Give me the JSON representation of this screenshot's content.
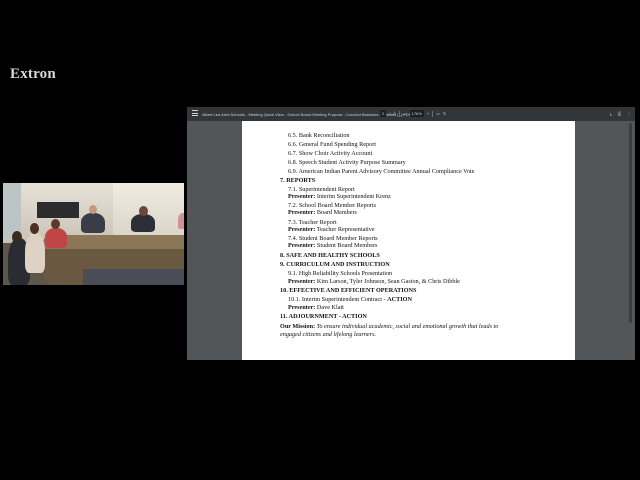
{
  "brand": {
    "logo": "Extron"
  },
  "viewer": {
    "title": "Albert Lea Area Schools - Meeting Quick View - School Board Meeting Purpose : Conduct Business of District (1).PDF",
    "page_current": "2",
    "page_sep": "/",
    "page_total": "2",
    "zoom_out": "—",
    "zoom": "176%",
    "zoom_in": "+",
    "fit_icon": "fit-page-icon",
    "rotate_icon": "rotate-icon",
    "download_icon": "⤓",
    "print_icon": "⎙",
    "more_icon": "⋮"
  },
  "doc": {
    "l1": "6.5. Bank Reconciliation",
    "l2": "6.6. General Fund Spending Report",
    "l3": "6.7. Show Choir Activity Account",
    "l4": "6.8. Speech Student Activity Purpose Summary",
    "l5": "6.9. American Indian Parent Advisory Committee Annual Compliance Vote",
    "h7": "7. REPORTS",
    "r1": "7.1. Superintendent Report",
    "p1_label": "Presenter:",
    "p1_name": "Interim Superintendent Krenz",
    "r2": "7.2. School Board Member Reports",
    "p2_label": "Presenter:",
    "p2_name": "Board Members",
    "r3": "7.3. Teacher Report",
    "p3_label": "Presenter:",
    "p3_name": "Teacher Representative",
    "r4": "7.4. Student Board Member Reports",
    "p4_label": "Presenter:",
    "p4_name": "Student Board Members",
    "h8": "8. SAFE AND HEALTHY SCHOOLS",
    "h9": "9. CURRICULUM AND INSTRUCTION",
    "c1": "9.1. High Reliability Schools Presentation",
    "p5_label": "Presenter:",
    "p5_name": "Kim Larson, Tyler Johnson, Sean Gaston, & Chris Dibble",
    "h10": "10. EFFECTIVE AND EFFICIENT OPERATIONS",
    "e1": "10.1. Interim Superintendent Contract - ",
    "e1_action": "ACTION",
    "p6_label": "Presenter:",
    "p6_name": "Dave Klatt",
    "h11": "11. ADJOURNMENT - ACTION",
    "mission_label": "Our Mission:",
    "mission_text1": "To ensure individual academic, social and emotional growth that leads to",
    "mission_text2": "engaged citizens and lifelong learners."
  }
}
